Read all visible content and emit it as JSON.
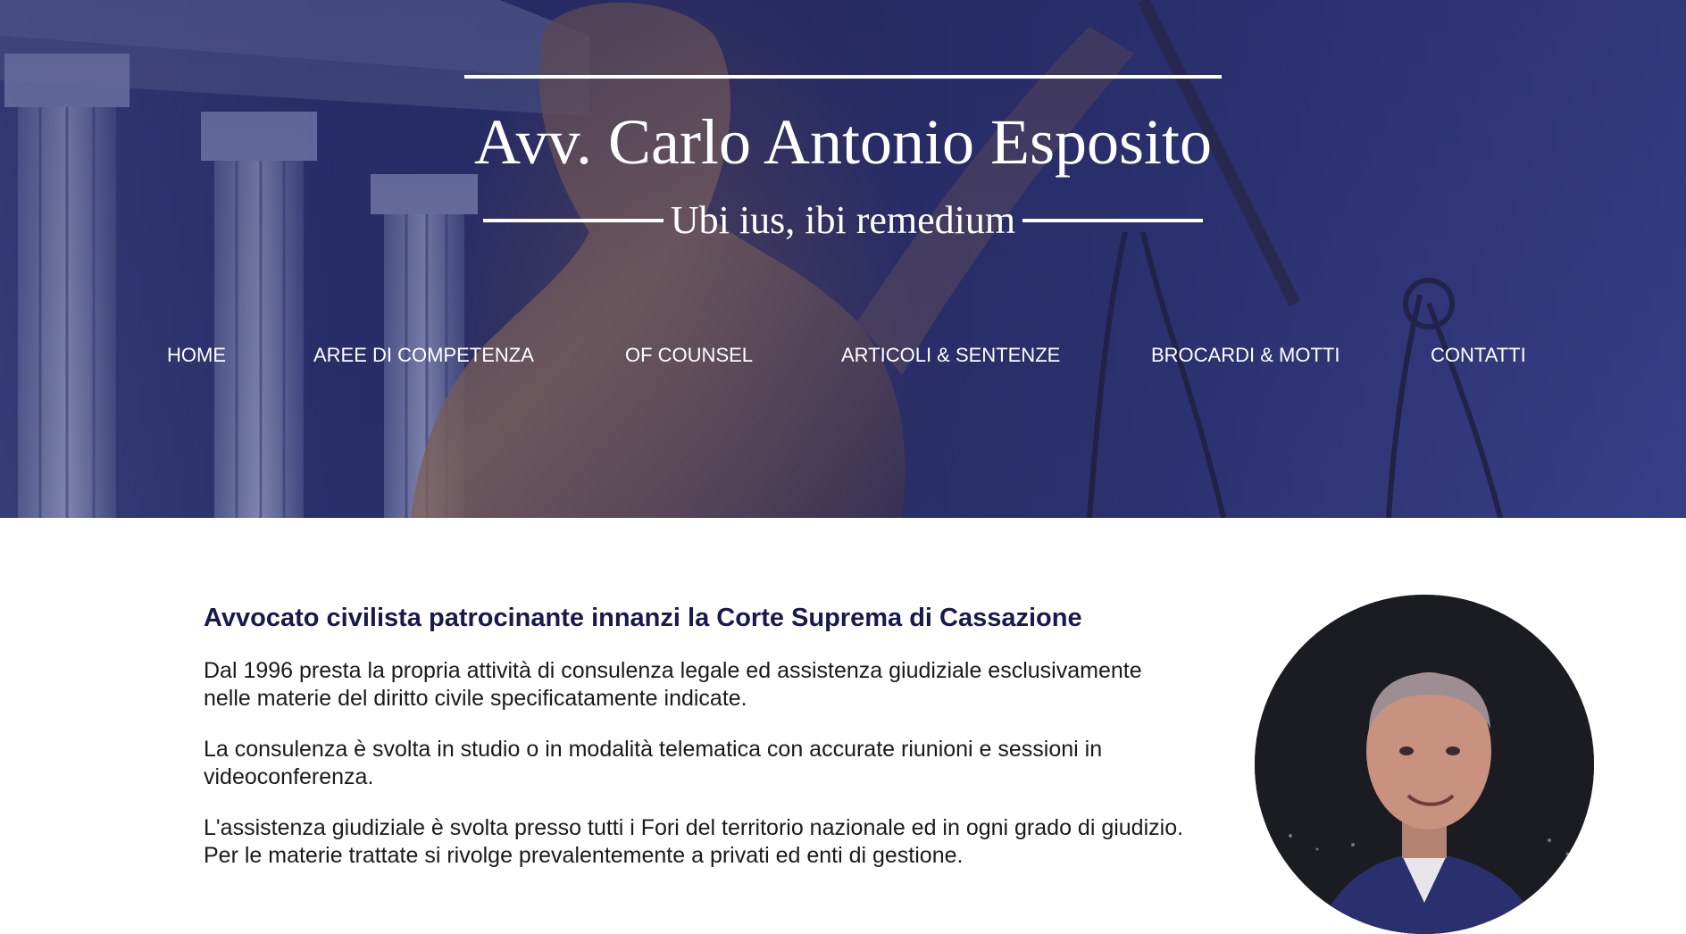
{
  "header": {
    "title": "Avv. Carlo Antonio Esposito",
    "motto": "Ubi ius, ibi remedium"
  },
  "nav": {
    "items": [
      {
        "label": "HOME"
      },
      {
        "label": "AREE DI COMPETENZA"
      },
      {
        "label": "OF COUNSEL"
      },
      {
        "label": "ARTICOLI & SENTENZE"
      },
      {
        "label": "BROCARDI & MOTTI"
      },
      {
        "label": "CONTATTI"
      }
    ]
  },
  "main": {
    "heading": "Avvocato civilista patrocinante innanzi la Corte Suprema di Cassazione",
    "paragraphs": [
      "Dal 1996 presta la propria attività di consulenza legale ed assistenza giudiziale esclusivamente nelle materie del diritto civile specificatamente indicate.",
      "La consulenza è svolta in studio o in modalità telematica con accurate riunioni e sessioni in videoconferenza.",
      "L'assistenza giudiziale è svolta presso tutti i Fori del territorio nazionale ed in ogni grado di giudizio. Per le materie trattate si rivolge prevalentemente a privati ed enti di gestione."
    ]
  },
  "colors": {
    "hero_overlay": "#2a2f6a",
    "heading": "#171a4a",
    "nav_text": "#ffffff"
  }
}
